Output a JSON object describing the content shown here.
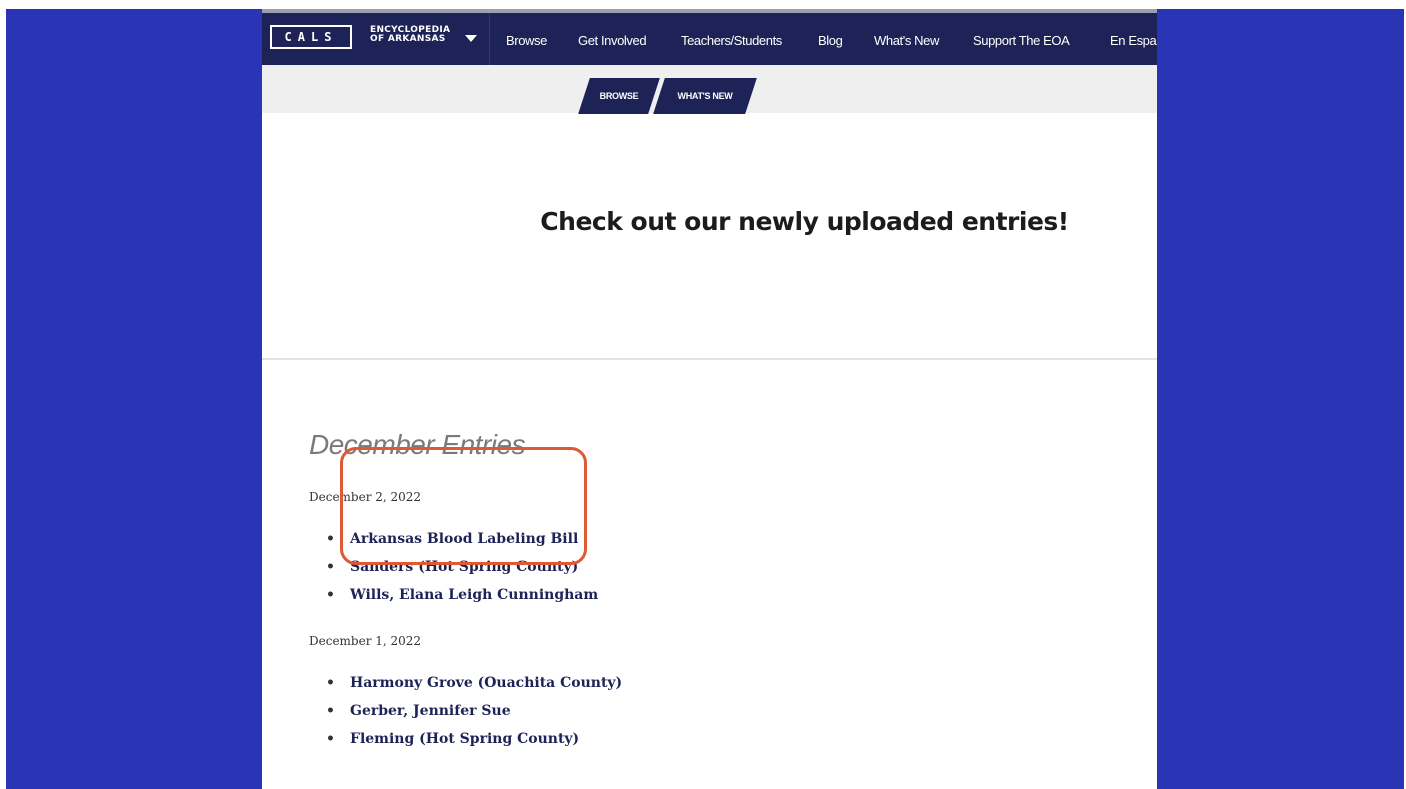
{
  "colors": {
    "slide_background": "#2a35b5",
    "navbar": "#1d2356",
    "link": "#1d2356",
    "highlight": "#dd5a33"
  },
  "header": {
    "logo_cals": "CALS",
    "logo_encyclopedia_line1": "ENCYCLOPEDIA",
    "logo_encyclopedia_line2": "OF ARKANSAS",
    "dropdown_icon": "caret-down-icon",
    "nav": [
      {
        "label": "Browse"
      },
      {
        "label": "Get Involved"
      },
      {
        "label": "Teachers/Students"
      },
      {
        "label": "Blog"
      },
      {
        "label": "What's New"
      },
      {
        "label": "Support The EOA"
      },
      {
        "label": "En Espa"
      }
    ]
  },
  "breadcrumb": [
    {
      "label": "BROWSE"
    },
    {
      "label": "WHAT'S NEW"
    }
  ],
  "hero": {
    "title": "Check out our newly uploaded entries!"
  },
  "section": {
    "heading": "December Entries",
    "groups": [
      {
        "date": "December 2, 2022",
        "entries": [
          "Arkansas Blood Labeling Bill",
          "Sanders (Hot Spring County)",
          "Wills, Elana Leigh Cunningham"
        ]
      },
      {
        "date": "December 1, 2022",
        "entries": [
          "Harmony Grove (Ouachita County)",
          "Gerber, Jennifer Sue",
          "Fleming (Hot Spring County)"
        ]
      }
    ]
  }
}
